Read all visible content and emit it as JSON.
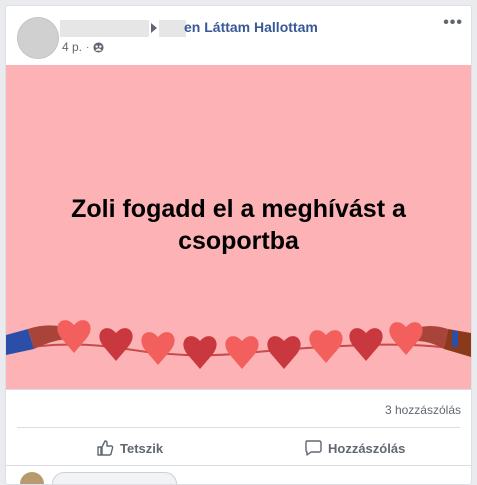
{
  "post": {
    "group_name": "en Láttam Hallottam",
    "time": "4 p.",
    "separator": "·",
    "image_text_line1": "Zoli fogadd el a meghívást a",
    "image_text_line2": "csoportba",
    "comments_count": "3 hozzászólás"
  },
  "actions": {
    "like_label": "Tetszik",
    "comment_label": "Hozzászólás"
  },
  "colors": {
    "hero_bg": "#fdb3b6",
    "link": "#385898"
  }
}
